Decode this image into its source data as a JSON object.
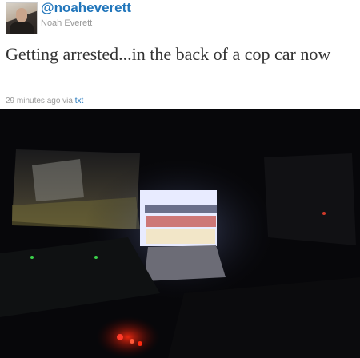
{
  "profile": {
    "handle": "@noaheverett",
    "name": "Noah Everett"
  },
  "tweet": {
    "text": "Getting arrested...in the back of a cop car now",
    "time": "29 minutes ago",
    "via_label": "via",
    "source": "txt"
  },
  "photo": {
    "subject": "dark interior of a police car at night with a lit laptop screen"
  },
  "colors": {
    "link": "#2276bb",
    "text": "#333333",
    "muted": "#999999"
  }
}
